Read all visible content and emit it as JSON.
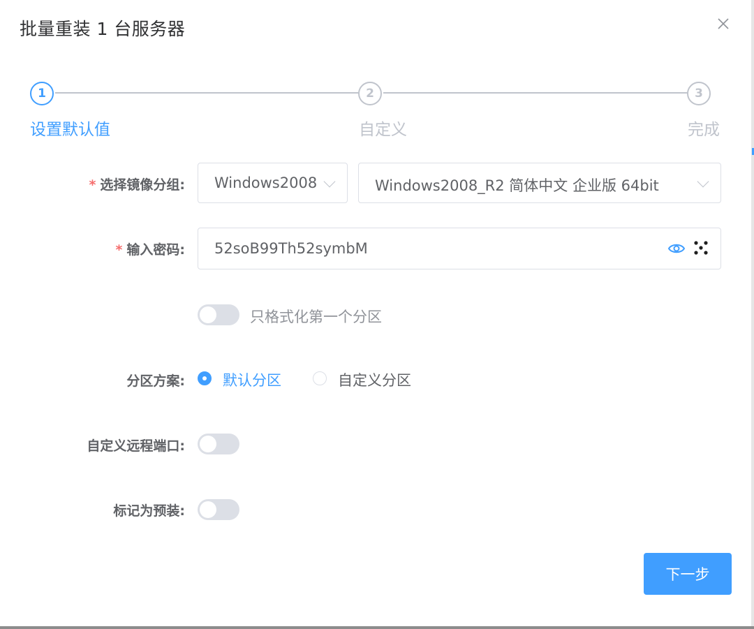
{
  "dialog": {
    "title": "批量重装 1 台服务器"
  },
  "steps": [
    {
      "number": "1",
      "label": "设置默认值",
      "active": true
    },
    {
      "number": "2",
      "label": "自定义",
      "active": false
    },
    {
      "number": "3",
      "label": "完成",
      "active": false
    }
  ],
  "form": {
    "image_group": {
      "label": "选择镜像分组:",
      "required": "*",
      "group_value": "Windows2008",
      "image_value": "Windows2008_R2 简体中文 企业版 64bit"
    },
    "password": {
      "label": "输入密码:",
      "required": "*",
      "value": "52soB99Th52symbM"
    },
    "format_first_partition": {
      "label": "只格式化第一个分区",
      "enabled": false
    },
    "partition_scheme": {
      "label": "分区方案:",
      "options": [
        {
          "label": "默认分区",
          "checked": true
        },
        {
          "label": "自定义分区",
          "checked": false
        }
      ]
    },
    "custom_remote_port": {
      "label": "自定义远程端口:",
      "enabled": false
    },
    "mark_preinstall": {
      "label": "标记为预装:",
      "enabled": false
    }
  },
  "footer": {
    "next_label": "下一步"
  },
  "colors": {
    "accent": "#409eff",
    "required": "#f56c6c",
    "inactive": "#c0c4cc"
  }
}
